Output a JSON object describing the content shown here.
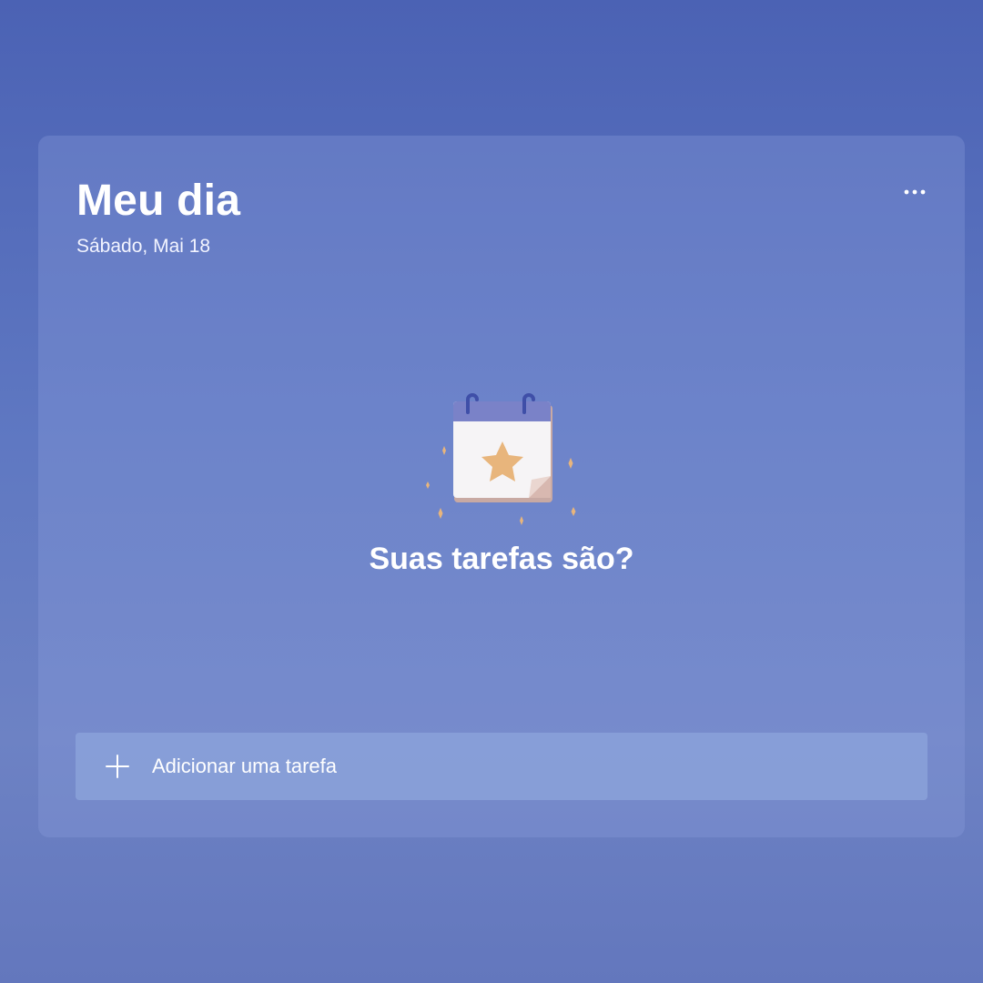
{
  "header": {
    "title": "Meu dia",
    "date": "Sábado, Mai 18",
    "more_icon": "more-horizontal-icon"
  },
  "empty_state": {
    "illustration_icon": "calendar-star-icon",
    "message": "Suas tarefas são?"
  },
  "add_task": {
    "icon": "plus-icon",
    "label": "Adicionar uma tarefa"
  },
  "colors": {
    "background": "#4b62b4",
    "accent_star": "#e8b57c",
    "text": "#ffffff"
  }
}
